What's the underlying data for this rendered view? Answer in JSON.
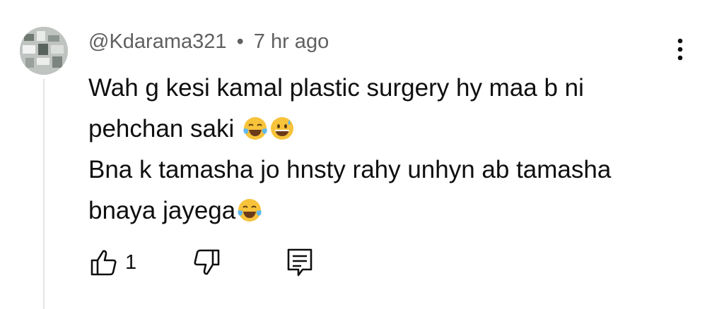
{
  "comment": {
    "author": "@Kdarama321",
    "separator": "•",
    "time": "7 hr ago",
    "lines": [
      "Wah g kesi  kamal plastic surgery hy maa b ni",
      "pehchan saki",
      "Bna k tamasha jo hnsty rahy unhyn ab tamasha",
      "bnaya jayega"
    ],
    "like_count": "1"
  },
  "icons": {
    "more": "more-vertical-icon",
    "like": "thumb-up-icon",
    "dislike": "thumb-down-icon",
    "reply": "reply-comment-icon"
  },
  "colors": {
    "meta": "#606060",
    "text": "#0f0f0f",
    "thread_line": "#e5e5e5",
    "emoji": "#f7c33b"
  }
}
